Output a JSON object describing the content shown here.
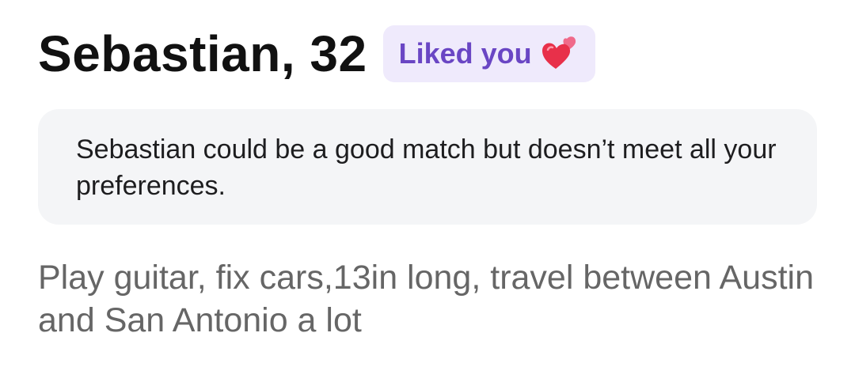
{
  "profile": {
    "name_age": "Sebastian, 32",
    "badge": {
      "label": "Liked you",
      "icon": "two-hearts-icon",
      "background": "#efeafc",
      "text_color": "#6a46c4"
    },
    "match_notice": "Sebastian could be a good match but doesn’t meet all your preferences.",
    "bio": "Play guitar, fix cars,13in long, travel between Austin and San Antonio a lot"
  }
}
